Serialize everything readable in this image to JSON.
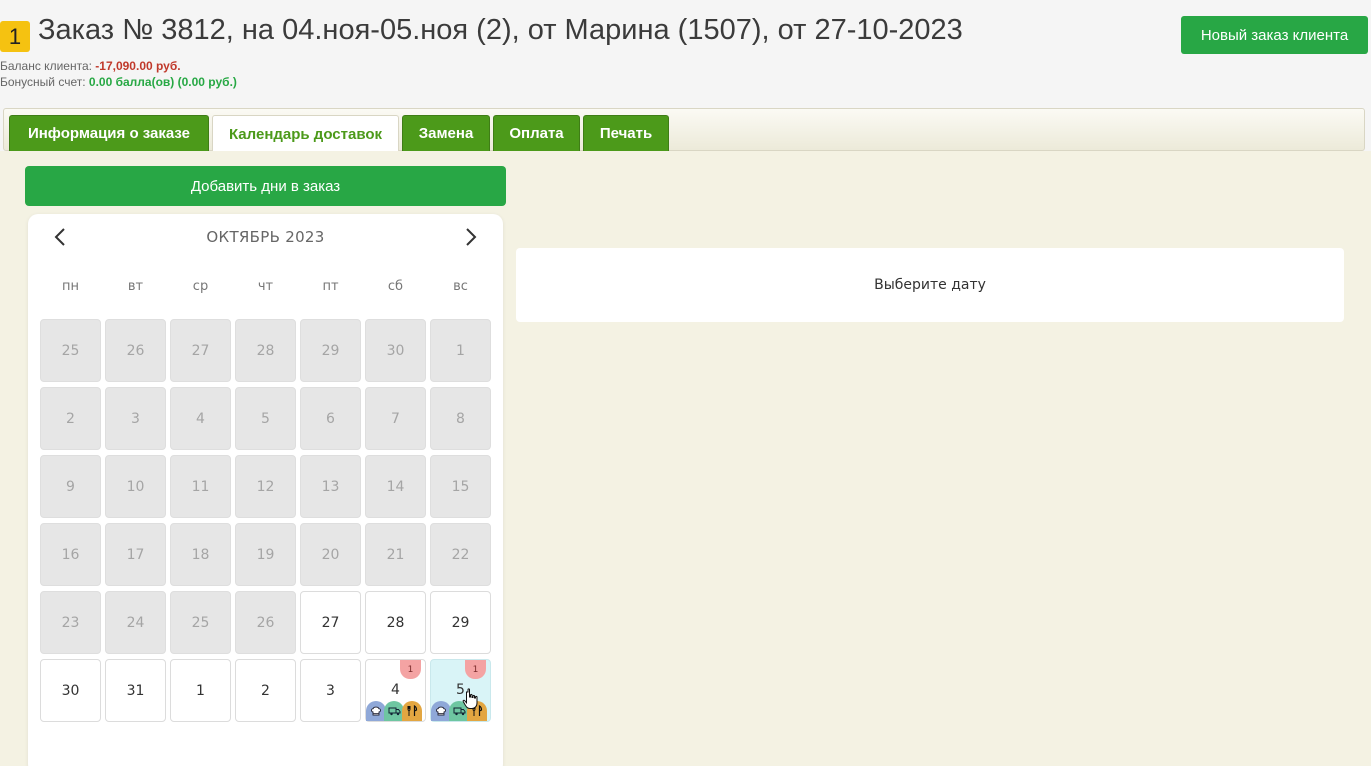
{
  "header": {
    "badge": "1",
    "title": "Заказ № 3812, на 04.ноя-05.ноя (2), от Марина (1507), от 27-10-2023",
    "balance_label": "Баланс клиента: ",
    "balance_value": "-17,090.00 руб.",
    "bonus_label": "Бонусный счет: ",
    "bonus_value": "0.00 балла(ов) (0.00 руб.)",
    "new_order_button": "Новый заказ клиента"
  },
  "tabs": [
    {
      "label": "Информация о заказе",
      "active": false
    },
    {
      "label": "Календарь доставок",
      "active": true
    },
    {
      "label": "Замена",
      "active": false
    },
    {
      "label": "Оплата",
      "active": false
    },
    {
      "label": "Печать",
      "active": false
    }
  ],
  "add_days_button": "Добавить дни в заказ",
  "calendar": {
    "month_label": "ОКТЯБРЬ 2023",
    "weekdays": [
      "пн",
      "вт",
      "ср",
      "чт",
      "пт",
      "сб",
      "вс"
    ],
    "weeks": [
      [
        {
          "d": "25",
          "s": "muted"
        },
        {
          "d": "26",
          "s": "muted"
        },
        {
          "d": "27",
          "s": "muted"
        },
        {
          "d": "28",
          "s": "muted"
        },
        {
          "d": "29",
          "s": "muted"
        },
        {
          "d": "30",
          "s": "muted"
        },
        {
          "d": "1",
          "s": "muted"
        }
      ],
      [
        {
          "d": "2",
          "s": "muted"
        },
        {
          "d": "3",
          "s": "muted"
        },
        {
          "d": "4",
          "s": "muted"
        },
        {
          "d": "5",
          "s": "muted"
        },
        {
          "d": "6",
          "s": "muted"
        },
        {
          "d": "7",
          "s": "muted"
        },
        {
          "d": "8",
          "s": "muted"
        }
      ],
      [
        {
          "d": "9",
          "s": "muted"
        },
        {
          "d": "10",
          "s": "muted"
        },
        {
          "d": "11",
          "s": "muted"
        },
        {
          "d": "12",
          "s": "muted"
        },
        {
          "d": "13",
          "s": "muted"
        },
        {
          "d": "14",
          "s": "muted"
        },
        {
          "d": "15",
          "s": "muted"
        }
      ],
      [
        {
          "d": "16",
          "s": "muted"
        },
        {
          "d": "17",
          "s": "muted"
        },
        {
          "d": "18",
          "s": "muted"
        },
        {
          "d": "19",
          "s": "muted"
        },
        {
          "d": "20",
          "s": "muted"
        },
        {
          "d": "21",
          "s": "muted"
        },
        {
          "d": "22",
          "s": "muted"
        }
      ],
      [
        {
          "d": "23",
          "s": "muted"
        },
        {
          "d": "24",
          "s": "muted"
        },
        {
          "d": "25",
          "s": "muted"
        },
        {
          "d": "26",
          "s": "muted"
        },
        {
          "d": "27",
          "s": "cur"
        },
        {
          "d": "28",
          "s": "cur"
        },
        {
          "d": "29",
          "s": "cur"
        }
      ],
      [
        {
          "d": "30",
          "s": "cur"
        },
        {
          "d": "31",
          "s": "cur"
        },
        {
          "d": "1",
          "s": "cur"
        },
        {
          "d": "2",
          "s": "cur"
        },
        {
          "d": "3",
          "s": "cur"
        },
        {
          "d": "4",
          "s": "cur",
          "count": "1",
          "icons": [
            "chef-icon",
            "truck-icon",
            "cutlery-icon"
          ]
        },
        {
          "d": "5",
          "s": "sel",
          "count": "1",
          "icons": [
            "chef-icon",
            "truck-icon",
            "cutlery-icon"
          ]
        }
      ]
    ]
  },
  "select_date_text": "Выберите дату",
  "colors": {
    "green": "#28a745",
    "tab_green": "#4c9a1a",
    "badge_yellow": "#f5c211",
    "negative": "#c0392b",
    "content_bg": "#f4f2e3",
    "selected_day": "#d9f4f7",
    "count_badge": "#f4a3a3"
  }
}
